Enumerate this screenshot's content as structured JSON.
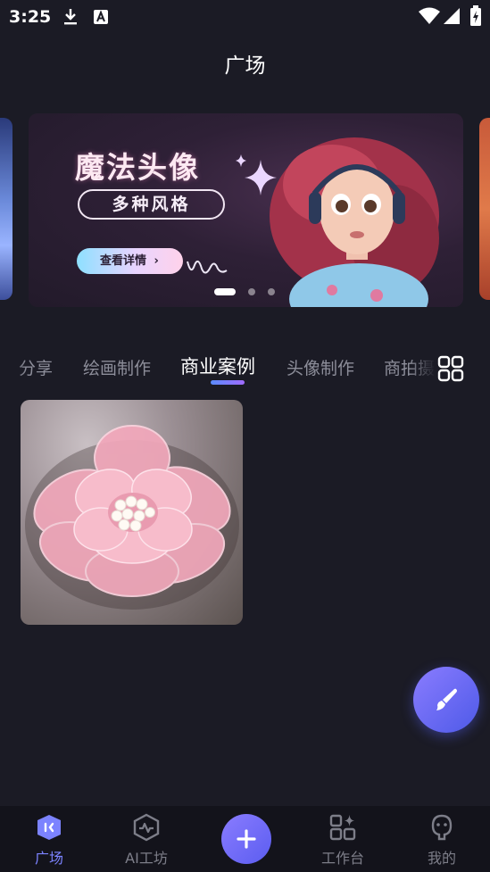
{
  "status_bar": {
    "time": "3:25",
    "icons": [
      "download-icon",
      "notification-a-icon",
      "wifi-icon",
      "signal-icon",
      "battery-charging-icon"
    ]
  },
  "header": {
    "title": "广场"
  },
  "banner": {
    "title": "魔法头像",
    "subtitle": "多种风格",
    "detail_button": "查看详情",
    "detail_chevron": "›",
    "active_index": 0,
    "total": 3
  },
  "tabs": {
    "items": [
      {
        "label": "分享",
        "active": false
      },
      {
        "label": "绘画制作",
        "active": false
      },
      {
        "label": "商业案例",
        "active": true
      },
      {
        "label": "头像制作",
        "active": false
      },
      {
        "label": "商拍摄",
        "active": false
      }
    ],
    "grid_icon": "grid-icon"
  },
  "gallery": {
    "items": [
      {
        "subject": "pink-flower-brooch-image"
      }
    ]
  },
  "fab": {
    "icon": "brush-icon"
  },
  "bottom_nav": {
    "items": [
      {
        "label": "广场",
        "icon": "plaza-icon",
        "active": true
      },
      {
        "label": "AI工坊",
        "icon": "ai-workshop-icon",
        "active": false
      },
      {
        "label": "",
        "icon": "plus-icon",
        "active": false
      },
      {
        "label": "工作台",
        "icon": "workbench-icon",
        "active": false
      },
      {
        "label": "我的",
        "icon": "profile-icon",
        "active": false
      }
    ]
  },
  "colors": {
    "background": "#1b1b25",
    "accent": "#7c83ff",
    "nav_background": "#13131b",
    "inactive_text": "#8d8e9a"
  }
}
